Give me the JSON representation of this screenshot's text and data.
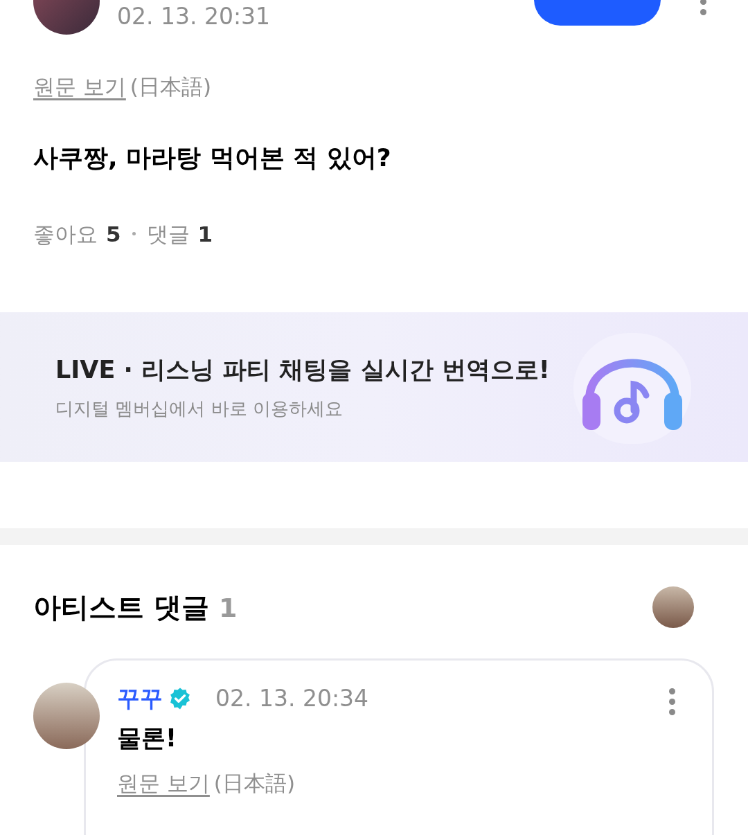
{
  "post": {
    "date": "02. 13. 20:31",
    "translation": {
      "link": "원문 보기",
      "language": "(日本語)"
    },
    "text": "사쿠짱, 마라탕 먹어본 적 있어?",
    "stats": [
      {
        "label": "좋아요",
        "count": "5"
      },
      {
        "label": "댓글",
        "count": "1"
      }
    ]
  },
  "banner": {
    "title": "LIVE · 리스닝 파티 채팅을 실시간 번역으로!",
    "subtitle": "디지털 멤버십에서 바로 이용하세요"
  },
  "artist_comments": {
    "title": "아티스트 댓글",
    "count": "1",
    "comments": [
      {
        "author": "꾸꾸",
        "verified": true,
        "date": "02. 13. 20:34",
        "text": "물론!",
        "translation": {
          "link": "원문 보기",
          "language": "(日本語)"
        }
      }
    ]
  }
}
